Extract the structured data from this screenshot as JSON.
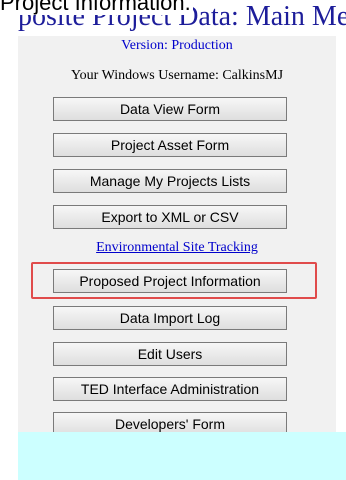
{
  "window": {
    "title": "posite Project Data: Main Me",
    "caption": "Project Information."
  },
  "header": {
    "version_label": "Version:",
    "version_value": "Production",
    "username_label": "Your Windows Username:",
    "username_value": "CalkinsMJ"
  },
  "menu": {
    "data_view_form": "Data View Form",
    "project_asset_form": "Project Asset Form",
    "manage_projects_lists": "Manage My Projects Lists",
    "export_xml_csv": "Export to XML or CSV",
    "environmental_site_tracking": "Environmental Site Tracking",
    "proposed_project_information": "Proposed Project Information",
    "data_import_log": "Data Import Log",
    "edit_users": "Edit Users",
    "ted_interface_admin": "TED Interface Administration",
    "developers_form": "Developers' Form"
  },
  "colors": {
    "highlight_border": "#e04b4b",
    "link": "#0000cc",
    "footer_band": "#ccffff"
  }
}
